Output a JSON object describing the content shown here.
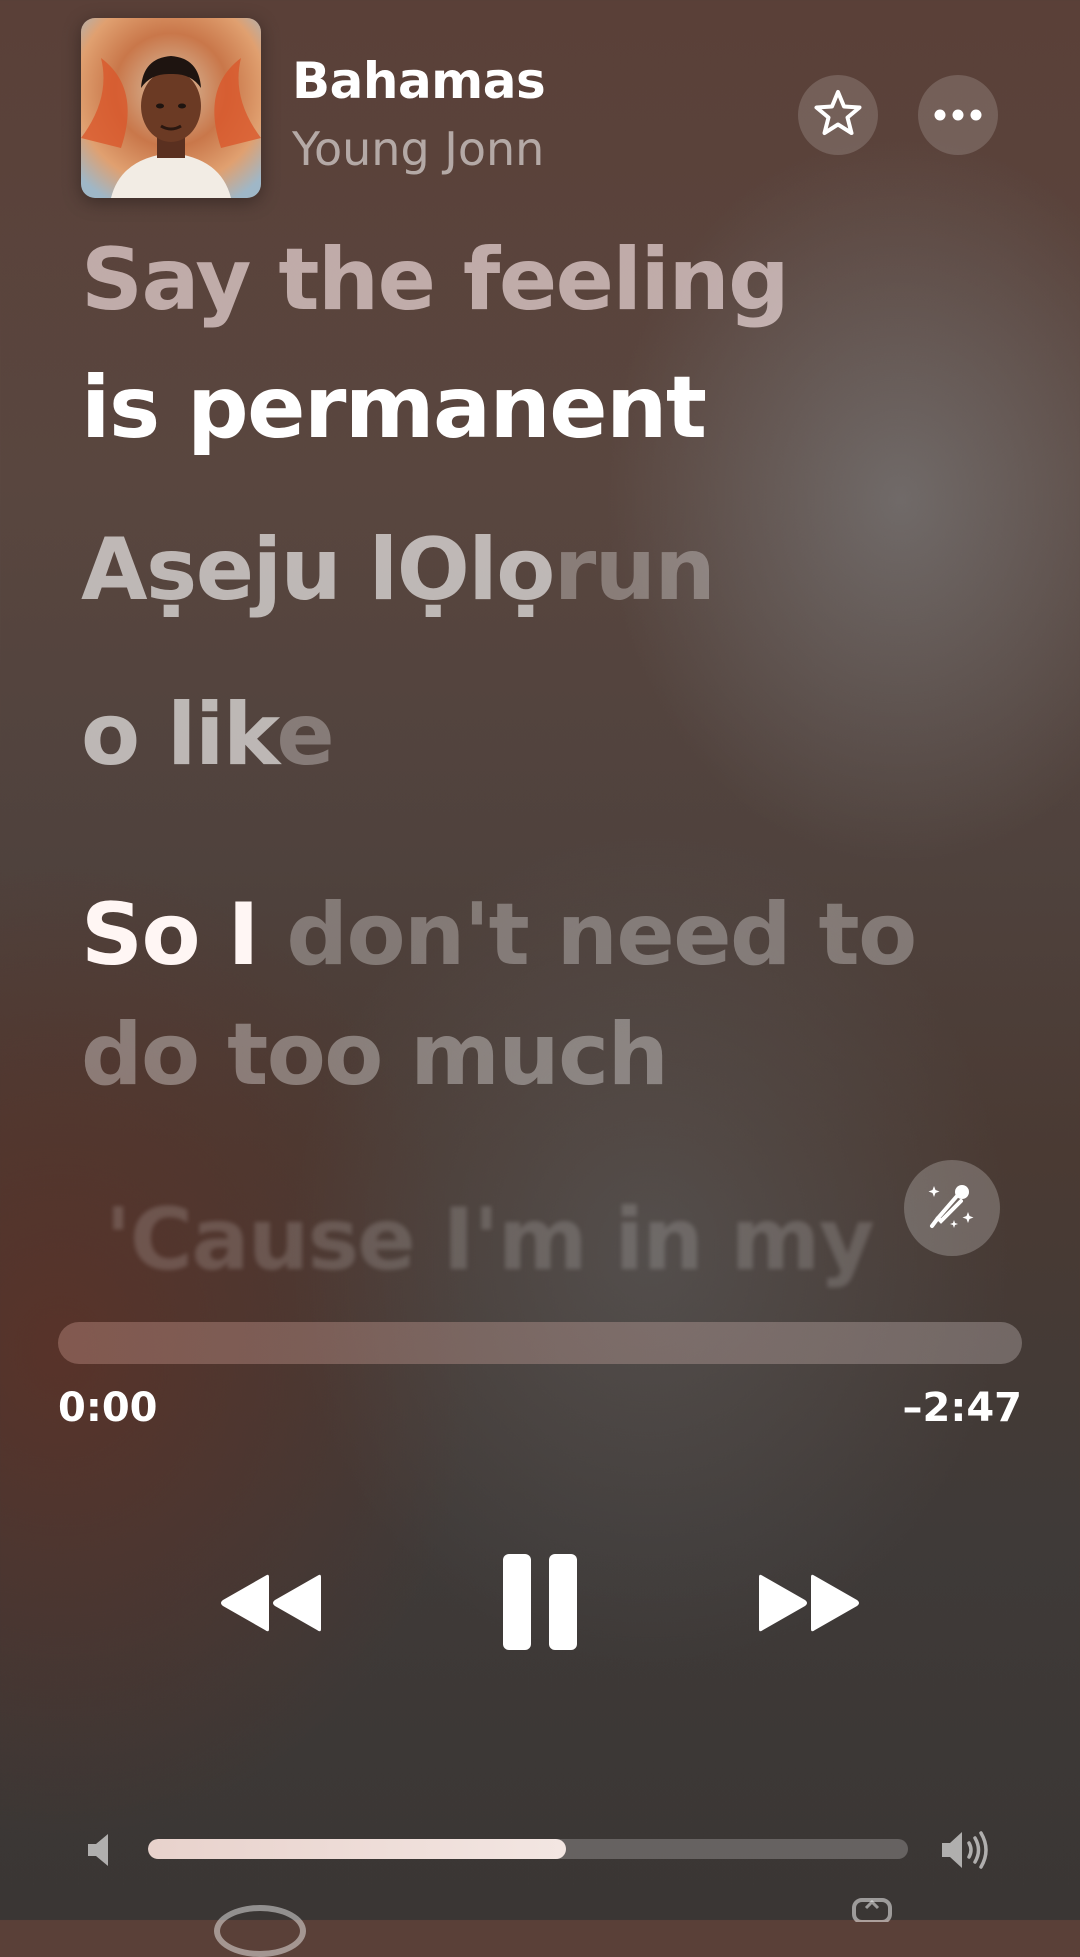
{
  "track": {
    "title": "Bahamas",
    "artist": "Young Jonn"
  },
  "header": {
    "favorite_icon": "star-icon",
    "more_icon": "ellipsis-icon"
  },
  "lyrics": [
    {
      "text": "Say the feeling",
      "state": "past"
    },
    {
      "text": "is permanent",
      "state": "active"
    },
    {
      "sung": "Aṣeju lỌlọ",
      "unsung": "run",
      "state": "dim"
    },
    {
      "sung": "o lik",
      "unsung": "e",
      "state": "dim"
    },
    {
      "sung": "So I",
      "unsung": " don't need to",
      "state": "partial"
    },
    {
      "text": "do too much",
      "state": "dim"
    },
    {
      "text": "'Cause I'm in my",
      "state": "faint"
    }
  ],
  "sing_button": {
    "icon": "microphone-sparkle-icon"
  },
  "playback": {
    "elapsed": "0:00",
    "remaining": "–2:47",
    "progress": 0.0
  },
  "controls": {
    "rewind_icon": "backward-icon",
    "pause_icon": "pause-icon",
    "forward_icon": "forward-icon"
  },
  "volume": {
    "level": 0.55,
    "low_icon": "speaker-low-icon",
    "high_icon": "speaker-high-icon"
  },
  "colors": {
    "text_primary": "#ffffff",
    "background_top": "#5a4038",
    "background_bottom": "#3a3634"
  }
}
